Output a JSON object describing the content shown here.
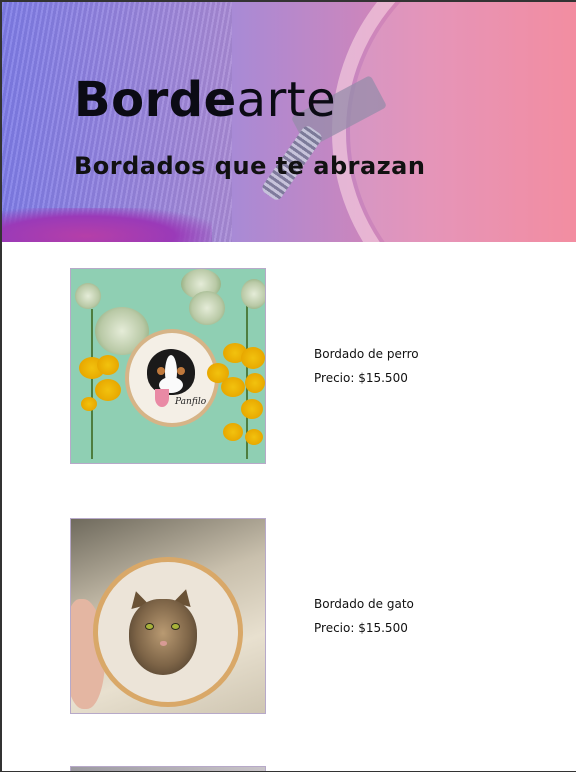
{
  "hero": {
    "title_bold": "Borde",
    "title_light": "arte",
    "subtitle": "Bordados que te abrazan"
  },
  "products": [
    {
      "name": "Bordado de perro",
      "price": "Precio: $15.500",
      "image": "embroidered-dog-hoop",
      "signature": "Panfilo"
    },
    {
      "name": "Bordado de gato",
      "price": "Precio: $15.500",
      "image": "embroidered-cat-hoop"
    }
  ],
  "colors": {
    "hero_gradient_start": "#7e7ce8",
    "hero_gradient_end": "#ef7a90",
    "background": "#ffffff",
    "text": "#111111"
  }
}
